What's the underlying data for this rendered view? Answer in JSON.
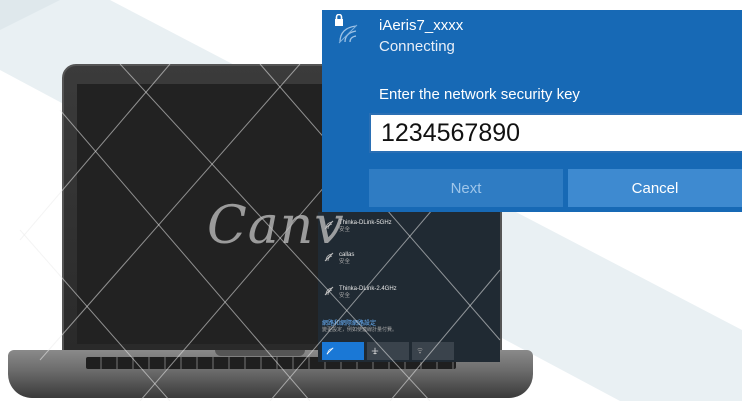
{
  "watermark": {
    "text": "Canv"
  },
  "wifi_list": {
    "networks": [
      {
        "name": "Thinka-DLink-5GHz",
        "status": "安全"
      },
      {
        "name": "callas",
        "status": "安全"
      },
      {
        "name": "Thinka-DLink-2.4GHz",
        "status": "安全"
      }
    ],
    "settings_link": "網路和網際網路設定",
    "settings_sub": "變更設定，例如使連線計量付費。",
    "quick_actions": [
      {
        "icon": "wifi-icon",
        "active": true
      },
      {
        "icon": "airplane-icon",
        "active": false
      },
      {
        "icon": "mobile-hotspot-icon",
        "active": false
      }
    ]
  },
  "popup": {
    "ssid": "iAeris7_xxxx",
    "status": "Connecting",
    "prompt": "Enter the network security key",
    "key_value": "1234567890",
    "next_label": "Next",
    "cancel_label": "Cancel",
    "icons": {
      "lock": "lock-icon",
      "wifi": "wifi-icon"
    }
  },
  "colors": {
    "popup_bg": "#1769b5",
    "next_bg": "#2f7cc3",
    "cancel_bg": "#3e8ad0",
    "list_bg": "#202a33",
    "link": "#6ab4ff"
  }
}
